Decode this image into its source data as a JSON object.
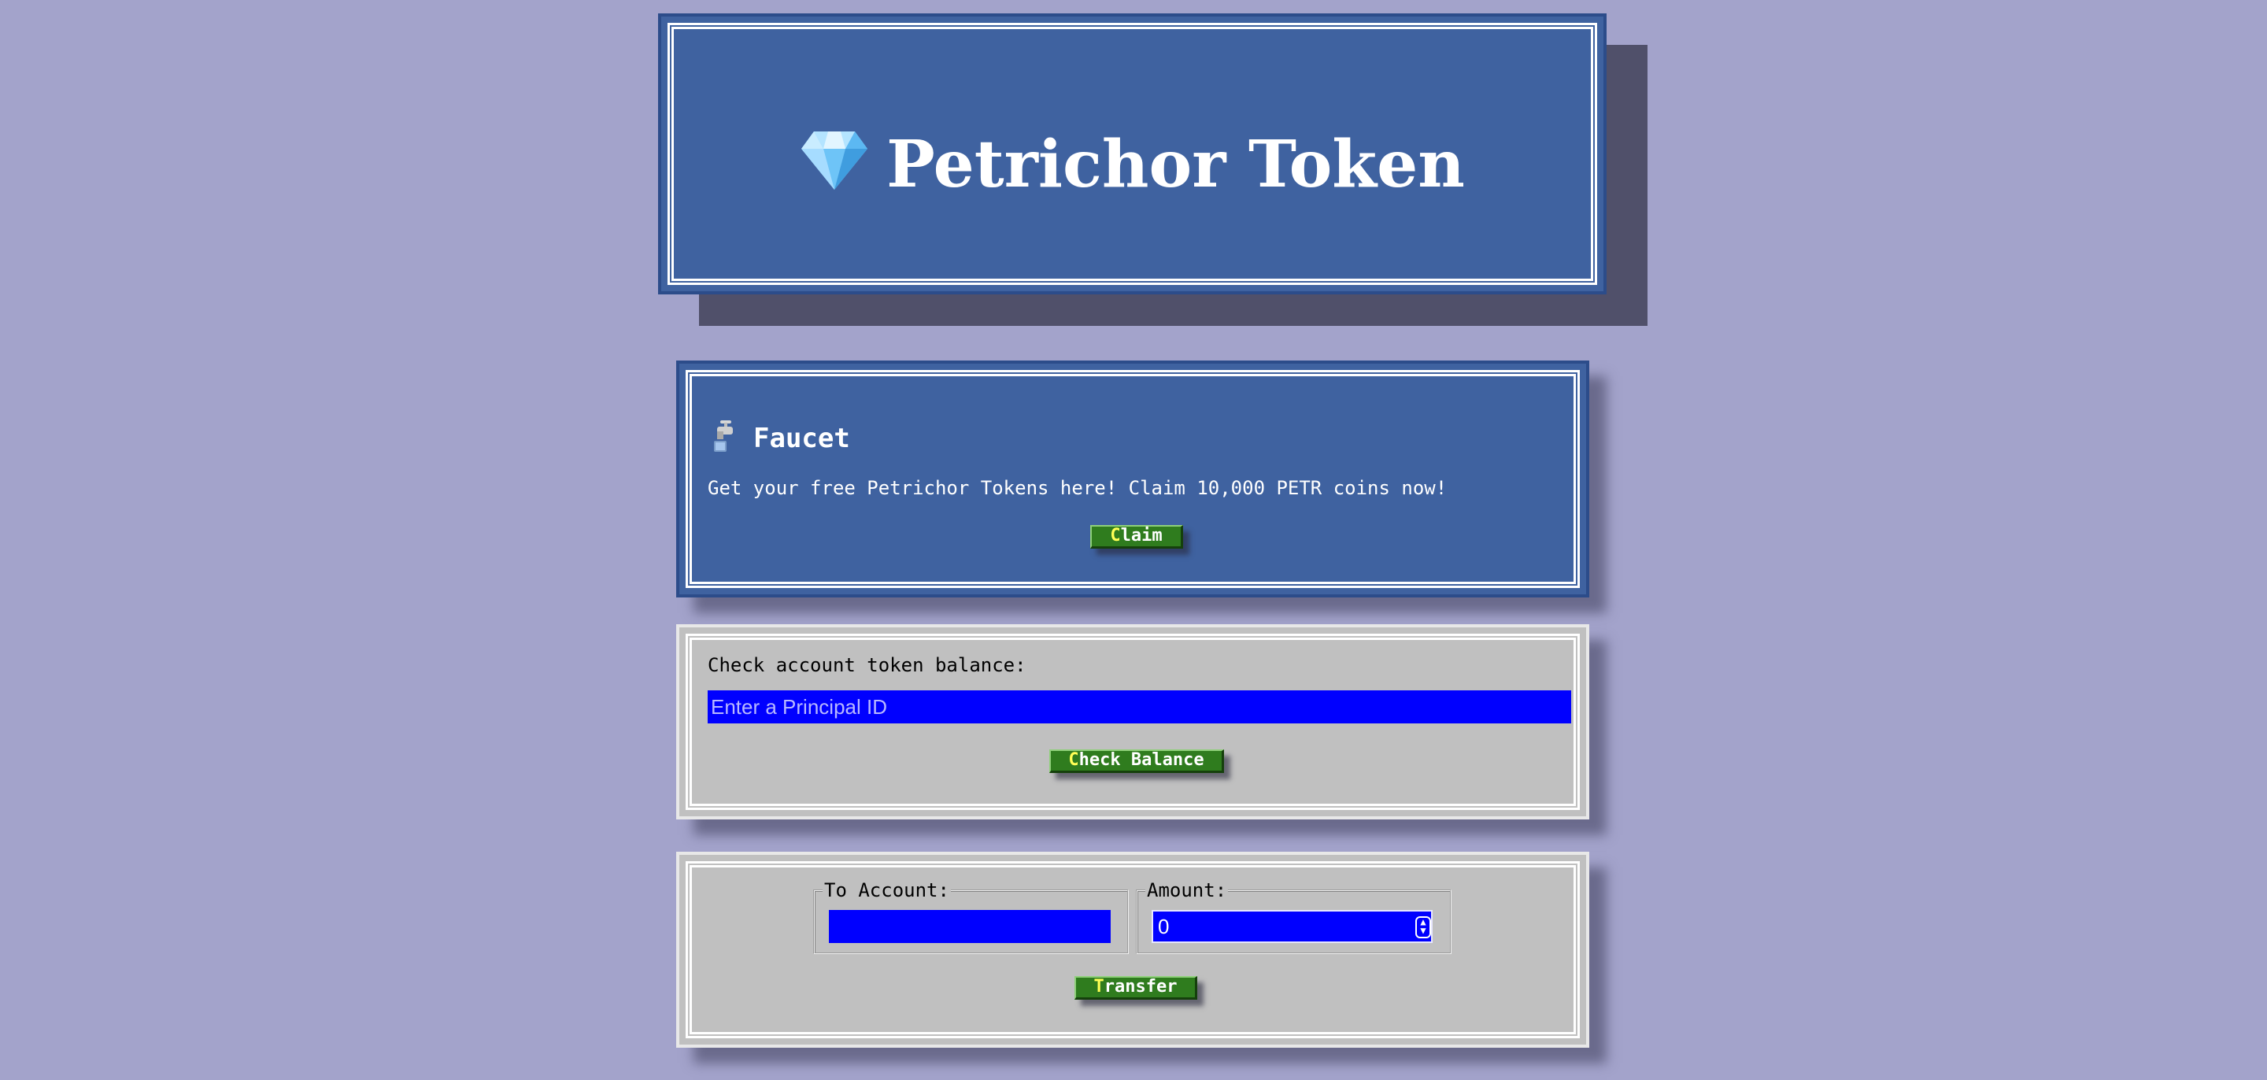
{
  "header": {
    "icon": "gem-icon",
    "title": "Petrichor Token"
  },
  "faucet": {
    "icon": "faucet-icon",
    "heading": "Faucet",
    "description": "Get your free Petrichor Tokens here! Claim 10,000 PETR coins now!",
    "claim_label_first": "C",
    "claim_label_rest": "laim"
  },
  "balance": {
    "label": "Check account token balance:",
    "input_placeholder": "Enter a Principal ID",
    "input_value": "",
    "button_label_first": "C",
    "button_label_rest": "heck Balance"
  },
  "transfer": {
    "to_account_legend": "To Account:",
    "to_account_value": "",
    "amount_legend": "Amount:",
    "amount_value": "0",
    "button_label_first": "T",
    "button_label_rest": "ransfer"
  },
  "colors": {
    "page_background": "#a3a3cb",
    "panel_blue": "#3f62a0",
    "panel_gray": "#c0c0c0",
    "input_blue": "#0000ff",
    "button_green": "#2f7c1e",
    "accesskey_yellow": "#ffff55"
  }
}
